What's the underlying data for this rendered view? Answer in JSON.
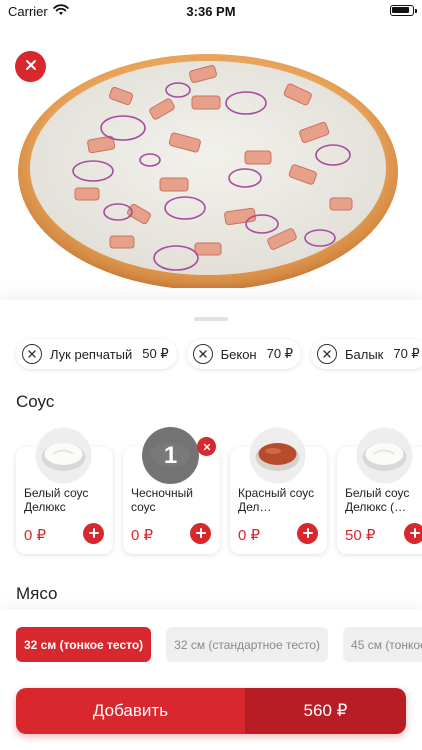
{
  "status_bar": {
    "carrier": "Carrier",
    "time": "3:36 PM"
  },
  "chips": [
    {
      "name": "Лук репчатый",
      "price": "50 ₽"
    },
    {
      "name": "Бекон",
      "price": "70 ₽"
    },
    {
      "name": "Балык",
      "price": "70 ₽"
    }
  ],
  "sections": {
    "sauce": "Соус",
    "meat": "Мясо"
  },
  "sauces": [
    {
      "name": "Белый соус Делюкс",
      "price": "0 ₽",
      "image": "white-sauce"
    },
    {
      "name": "Чесночный соус",
      "price": "0 ₽",
      "count": "1",
      "image": "garlic-sauce"
    },
    {
      "name": "Красный соус Дел…",
      "price": "0 ₽",
      "image": "red-sauce"
    },
    {
      "name": "Белый соус Делюкс (…",
      "price": "50 ₽",
      "image": "white-sauce"
    }
  ],
  "sizes": [
    {
      "label": "32 см (тонкое тесто)",
      "active": true
    },
    {
      "label": "32 см (стандартное тесто)",
      "active": false
    },
    {
      "label": "45 см (тонкое",
      "active": false
    }
  ],
  "cta": {
    "label": "Добавить",
    "price": "560 ₽"
  },
  "colors": {
    "accent": "#d9272e",
    "accent_dark": "#b81d25"
  }
}
